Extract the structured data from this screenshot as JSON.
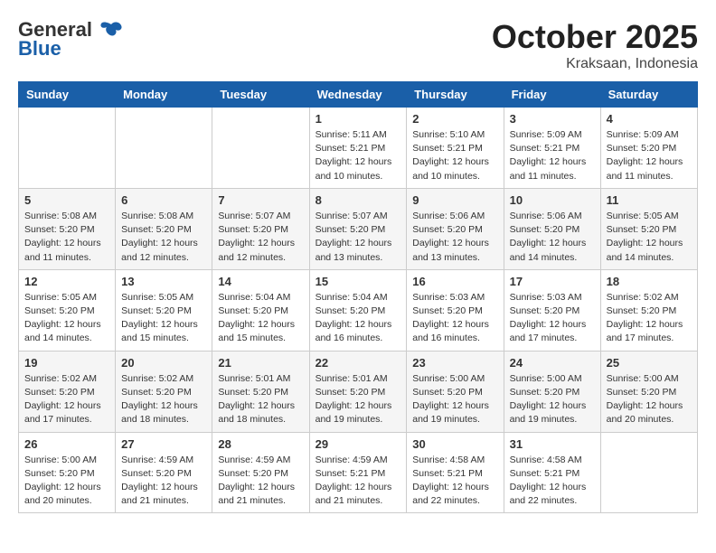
{
  "header": {
    "logo_line1": "General",
    "logo_line2": "Blue",
    "month": "October 2025",
    "location": "Kraksaan, Indonesia"
  },
  "weekdays": [
    "Sunday",
    "Monday",
    "Tuesday",
    "Wednesday",
    "Thursday",
    "Friday",
    "Saturday"
  ],
  "weeks": [
    [
      {
        "day": "",
        "info": ""
      },
      {
        "day": "",
        "info": ""
      },
      {
        "day": "",
        "info": ""
      },
      {
        "day": "1",
        "info": "Sunrise: 5:11 AM\nSunset: 5:21 PM\nDaylight: 12 hours\nand 10 minutes."
      },
      {
        "day": "2",
        "info": "Sunrise: 5:10 AM\nSunset: 5:21 PM\nDaylight: 12 hours\nand 10 minutes."
      },
      {
        "day": "3",
        "info": "Sunrise: 5:09 AM\nSunset: 5:21 PM\nDaylight: 12 hours\nand 11 minutes."
      },
      {
        "day": "4",
        "info": "Sunrise: 5:09 AM\nSunset: 5:20 PM\nDaylight: 12 hours\nand 11 minutes."
      }
    ],
    [
      {
        "day": "5",
        "info": "Sunrise: 5:08 AM\nSunset: 5:20 PM\nDaylight: 12 hours\nand 11 minutes."
      },
      {
        "day": "6",
        "info": "Sunrise: 5:08 AM\nSunset: 5:20 PM\nDaylight: 12 hours\nand 12 minutes."
      },
      {
        "day": "7",
        "info": "Sunrise: 5:07 AM\nSunset: 5:20 PM\nDaylight: 12 hours\nand 12 minutes."
      },
      {
        "day": "8",
        "info": "Sunrise: 5:07 AM\nSunset: 5:20 PM\nDaylight: 12 hours\nand 13 minutes."
      },
      {
        "day": "9",
        "info": "Sunrise: 5:06 AM\nSunset: 5:20 PM\nDaylight: 12 hours\nand 13 minutes."
      },
      {
        "day": "10",
        "info": "Sunrise: 5:06 AM\nSunset: 5:20 PM\nDaylight: 12 hours\nand 14 minutes."
      },
      {
        "day": "11",
        "info": "Sunrise: 5:05 AM\nSunset: 5:20 PM\nDaylight: 12 hours\nand 14 minutes."
      }
    ],
    [
      {
        "day": "12",
        "info": "Sunrise: 5:05 AM\nSunset: 5:20 PM\nDaylight: 12 hours\nand 14 minutes."
      },
      {
        "day": "13",
        "info": "Sunrise: 5:05 AM\nSunset: 5:20 PM\nDaylight: 12 hours\nand 15 minutes."
      },
      {
        "day": "14",
        "info": "Sunrise: 5:04 AM\nSunset: 5:20 PM\nDaylight: 12 hours\nand 15 minutes."
      },
      {
        "day": "15",
        "info": "Sunrise: 5:04 AM\nSunset: 5:20 PM\nDaylight: 12 hours\nand 16 minutes."
      },
      {
        "day": "16",
        "info": "Sunrise: 5:03 AM\nSunset: 5:20 PM\nDaylight: 12 hours\nand 16 minutes."
      },
      {
        "day": "17",
        "info": "Sunrise: 5:03 AM\nSunset: 5:20 PM\nDaylight: 12 hours\nand 17 minutes."
      },
      {
        "day": "18",
        "info": "Sunrise: 5:02 AM\nSunset: 5:20 PM\nDaylight: 12 hours\nand 17 minutes."
      }
    ],
    [
      {
        "day": "19",
        "info": "Sunrise: 5:02 AM\nSunset: 5:20 PM\nDaylight: 12 hours\nand 17 minutes."
      },
      {
        "day": "20",
        "info": "Sunrise: 5:02 AM\nSunset: 5:20 PM\nDaylight: 12 hours\nand 18 minutes."
      },
      {
        "day": "21",
        "info": "Sunrise: 5:01 AM\nSunset: 5:20 PM\nDaylight: 12 hours\nand 18 minutes."
      },
      {
        "day": "22",
        "info": "Sunrise: 5:01 AM\nSunset: 5:20 PM\nDaylight: 12 hours\nand 19 minutes."
      },
      {
        "day": "23",
        "info": "Sunrise: 5:00 AM\nSunset: 5:20 PM\nDaylight: 12 hours\nand 19 minutes."
      },
      {
        "day": "24",
        "info": "Sunrise: 5:00 AM\nSunset: 5:20 PM\nDaylight: 12 hours\nand 19 minutes."
      },
      {
        "day": "25",
        "info": "Sunrise: 5:00 AM\nSunset: 5:20 PM\nDaylight: 12 hours\nand 20 minutes."
      }
    ],
    [
      {
        "day": "26",
        "info": "Sunrise: 5:00 AM\nSunset: 5:20 PM\nDaylight: 12 hours\nand 20 minutes."
      },
      {
        "day": "27",
        "info": "Sunrise: 4:59 AM\nSunset: 5:20 PM\nDaylight: 12 hours\nand 21 minutes."
      },
      {
        "day": "28",
        "info": "Sunrise: 4:59 AM\nSunset: 5:20 PM\nDaylight: 12 hours\nand 21 minutes."
      },
      {
        "day": "29",
        "info": "Sunrise: 4:59 AM\nSunset: 5:21 PM\nDaylight: 12 hours\nand 21 minutes."
      },
      {
        "day": "30",
        "info": "Sunrise: 4:58 AM\nSunset: 5:21 PM\nDaylight: 12 hours\nand 22 minutes."
      },
      {
        "day": "31",
        "info": "Sunrise: 4:58 AM\nSunset: 5:21 PM\nDaylight: 12 hours\nand 22 minutes."
      },
      {
        "day": "",
        "info": ""
      }
    ]
  ]
}
